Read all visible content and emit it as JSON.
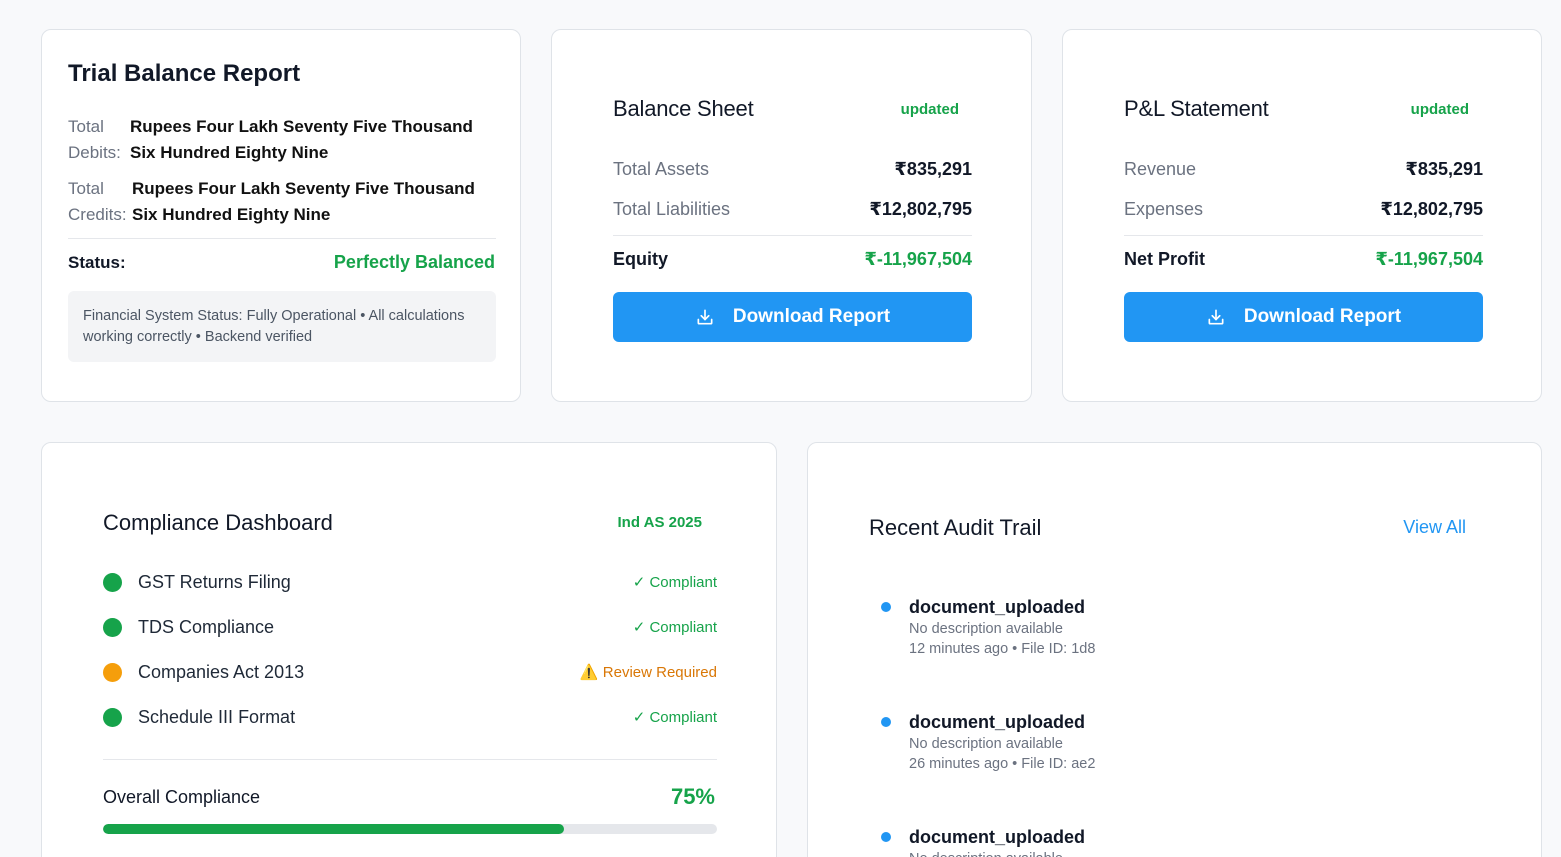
{
  "trial_balance": {
    "title": "Trial Balance Report",
    "debits_label": "Total Debits:",
    "debits_value": "Rupees Four Lakh Seventy Five Thousand Six Hundred Eighty Nine",
    "credits_label": "Total Credits:",
    "credits_value": "Rupees Four Lakh Seventy Five Thousand Six Hundred Eighty Nine",
    "status_label": "Status:",
    "status_value": "Perfectly Balanced",
    "note": "Financial System Status: Fully Operational • All calculations working correctly • Backend verified"
  },
  "balance_sheet": {
    "title": "Balance Sheet",
    "badge": "updated",
    "rows": [
      {
        "label": "Total Assets",
        "value": "₹835,291"
      },
      {
        "label": "Total Liabilities",
        "value": "₹12,802,795"
      },
      {
        "label": "Equity",
        "value": "₹-11,967,504"
      }
    ],
    "button_label": "Download Report"
  },
  "pl_statement": {
    "title": "P&L Statement",
    "badge": "updated",
    "rows": [
      {
        "label": "Revenue",
        "value": "₹835,291"
      },
      {
        "label": "Expenses",
        "value": "₹12,802,795"
      },
      {
        "label": "Net Profit",
        "value": "₹-11,967,504"
      }
    ],
    "button_label": "Download Report"
  },
  "compliance": {
    "title": "Compliance Dashboard",
    "badge": "Ind AS 2025",
    "items": [
      {
        "name": "GST Returns Filing",
        "status": "✓ Compliant"
      },
      {
        "name": "TDS Compliance",
        "status": "✓ Compliant"
      },
      {
        "name": "Companies Act 2013",
        "status": "⚠️ Review Required"
      },
      {
        "name": "Schedule III Format",
        "status": "✓ Compliant"
      }
    ],
    "overall_label": "Overall Compliance",
    "overall_value": "75%",
    "overall_fraction": 0.75
  },
  "audit_trail": {
    "title": "Recent Audit Trail",
    "view_all": "View All",
    "items": [
      {
        "event": "document_uploaded",
        "description": "No description available",
        "meta": "12 minutes ago • File ID: 1d8"
      },
      {
        "event": "document_uploaded",
        "description": "No description available",
        "meta": "26 minutes ago • File ID: ae2"
      },
      {
        "event": "document_uploaded",
        "description": "No description available",
        "meta": ""
      }
    ]
  },
  "colors": {
    "accent_blue": "#2196f3",
    "success_green": "#16a34a",
    "warning_orange": "#f59e0b"
  }
}
